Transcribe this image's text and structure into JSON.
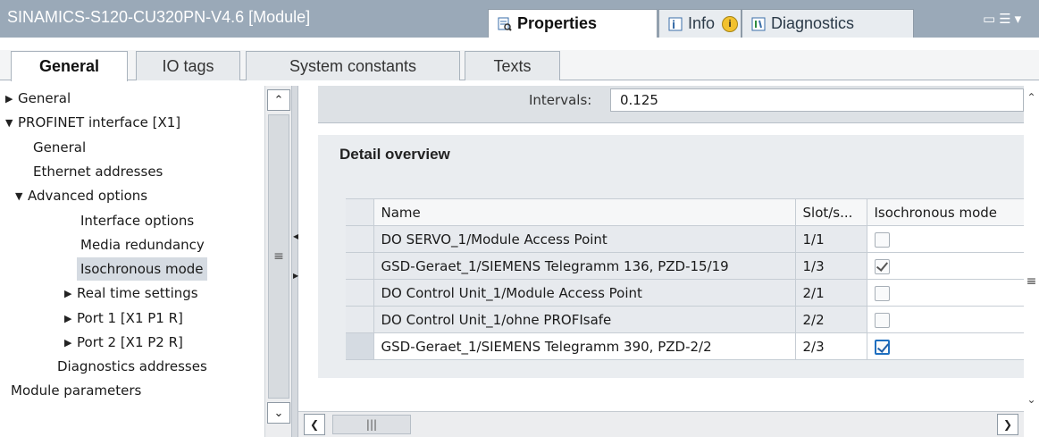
{
  "window": {
    "title": "SINAMICS-S120-CU320PN-V4.6 [Module]",
    "tabs": [
      {
        "label": "Properties",
        "icon": "properties-icon"
      },
      {
        "label": "Info",
        "icon": "info-icon"
      },
      {
        "label": "Diagnostics",
        "icon": "diagnostics-icon"
      }
    ],
    "info_badge": "i"
  },
  "subtabs": [
    "General",
    "IO tags",
    "System constants",
    "Texts"
  ],
  "tree": [
    {
      "label": "General",
      "level": 0,
      "toggle": "collapsed"
    },
    {
      "label": "PROFINET interface [X1]",
      "level": 0,
      "toggle": "expanded"
    },
    {
      "label": "General",
      "level": 1,
      "toggle": "none"
    },
    {
      "label": "Ethernet addresses",
      "level": 1,
      "toggle": "none"
    },
    {
      "label": "Advanced options",
      "level": 1,
      "toggle": "expanded"
    },
    {
      "label": "Interface options",
      "level": 2,
      "toggle": "none"
    },
    {
      "label": "Media redundancy",
      "level": 2,
      "toggle": "none"
    },
    {
      "label": "Isochronous mode",
      "level": 2,
      "toggle": "none",
      "selected": true
    },
    {
      "label": "Real time settings",
      "level": 2,
      "toggle": "collapsed"
    },
    {
      "label": "Port 1 [X1 P1 R]",
      "level": 2,
      "toggle": "collapsed"
    },
    {
      "label": "Port 2 [X1 P2 R]",
      "level": 2,
      "toggle": "collapsed"
    },
    {
      "label": "Diagnostics addresses",
      "level": 1,
      "toggle": "none"
    },
    {
      "label": "Module parameters",
      "level": 0,
      "toggle": "none"
    }
  ],
  "content": {
    "intervals_label": "Intervals:",
    "intervals_value": "0.125",
    "detail_title": "Detail overview",
    "columns": [
      "Name",
      "Slot/s...",
      "Isochronous mode"
    ],
    "rows": [
      {
        "name": "DO SERVO_1/Module Access Point",
        "slot": "1/1",
        "iso": false
      },
      {
        "name": "GSD-Geraet_1/SIEMENS Telegramm 136, PZD-15/19",
        "slot": "1/3",
        "iso": true
      },
      {
        "name": "DO Control Unit_1/Module Access Point",
        "slot": "2/1",
        "iso": false
      },
      {
        "name": "DO Control Unit_1/ohne PROFIsafe",
        "slot": "2/2",
        "iso": false
      },
      {
        "name": "GSD-Geraet_1/SIEMENS Telegramm 390, PZD-2/2",
        "slot": "2/3",
        "iso": true,
        "active": true
      }
    ]
  },
  "colors": {
    "titlebar": "#9aa9b8",
    "selection": "#d5dbe2",
    "panel": "#eaedf0",
    "focus": "#1f6fc0"
  }
}
